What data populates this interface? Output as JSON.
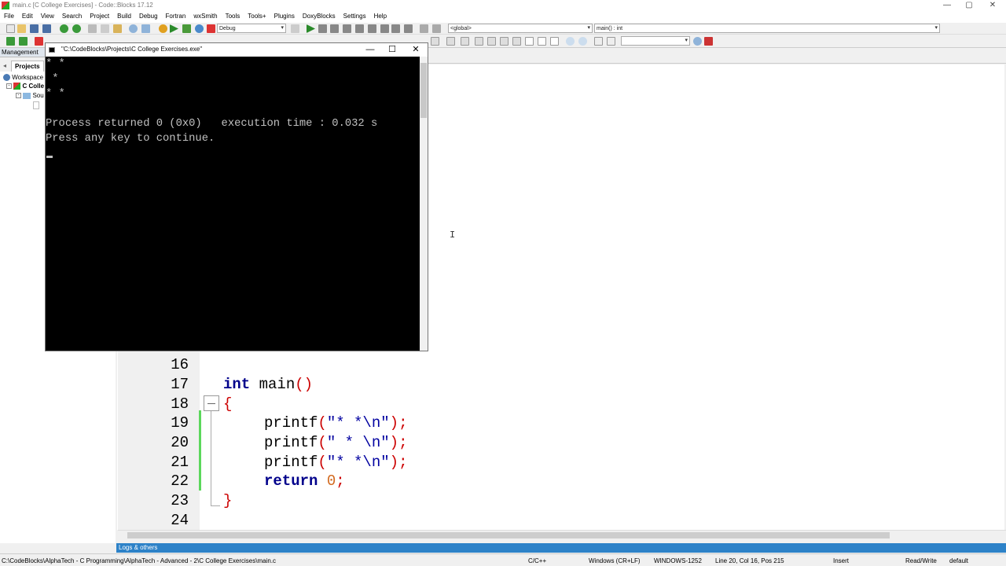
{
  "window": {
    "title": "main.c [C College Exercises] - Code::Blocks 17.12",
    "controls": [
      "—",
      "▢",
      "✕"
    ]
  },
  "menu": [
    "File",
    "Edit",
    "View",
    "Search",
    "Project",
    "Build",
    "Debug",
    "Fortran",
    "wxSmith",
    "Tools",
    "Tools+",
    "Plugins",
    "DoxyBlocks",
    "Settings",
    "Help"
  ],
  "toolbar": {
    "build_target": "Debug",
    "scope": "<global>",
    "symbol": "main() : int"
  },
  "management": {
    "header": "Management",
    "tab_projects": "Projects",
    "workspace": "Workspace",
    "project": "C Colle",
    "folder": "Sou"
  },
  "console": {
    "title": "\"C:\\CodeBlocks\\Projects\\C College Exercises.exe\"",
    "output": "* *\n *\n* *\n\nProcess returned 0 (0x0)   execution time : 0.032 s\nPress any key to continue.",
    "controls": [
      "—",
      "☐",
      "✕"
    ]
  },
  "editor": {
    "lines": [
      {
        "num": "16",
        "code": ""
      },
      {
        "num": "17",
        "code": "int main()"
      },
      {
        "num": "18",
        "code": "{"
      },
      {
        "num": "19",
        "code": "printf(\"* *\\n\");"
      },
      {
        "num": "20",
        "code": "printf(\" * \\n\");"
      },
      {
        "num": "21",
        "code": "printf(\"* *\\n\");"
      },
      {
        "num": "22",
        "code": "return 0;"
      },
      {
        "num": "23",
        "code": "}"
      },
      {
        "num": "24",
        "code": ""
      }
    ]
  },
  "logs": "Logs & others",
  "status": {
    "path": "C:\\CodeBlocks\\AlphaTech - C Programming\\AlphaTech - Advanced - 2\\C College Exercises\\main.c",
    "language": "C/C++",
    "eol": "Windows (CR+LF)",
    "encoding": "WINDOWS-1252",
    "position": "Line 20, Col 16, Pos 215",
    "mode": "Insert",
    "access": "Read/Write",
    "profile": "default"
  },
  "colors": {
    "keyword": "#00008b",
    "string": "#0000a0",
    "punct": "#cc0000",
    "number": "#d2691e",
    "changebar": "#5bd75b",
    "logbar": "#2d82c8"
  }
}
